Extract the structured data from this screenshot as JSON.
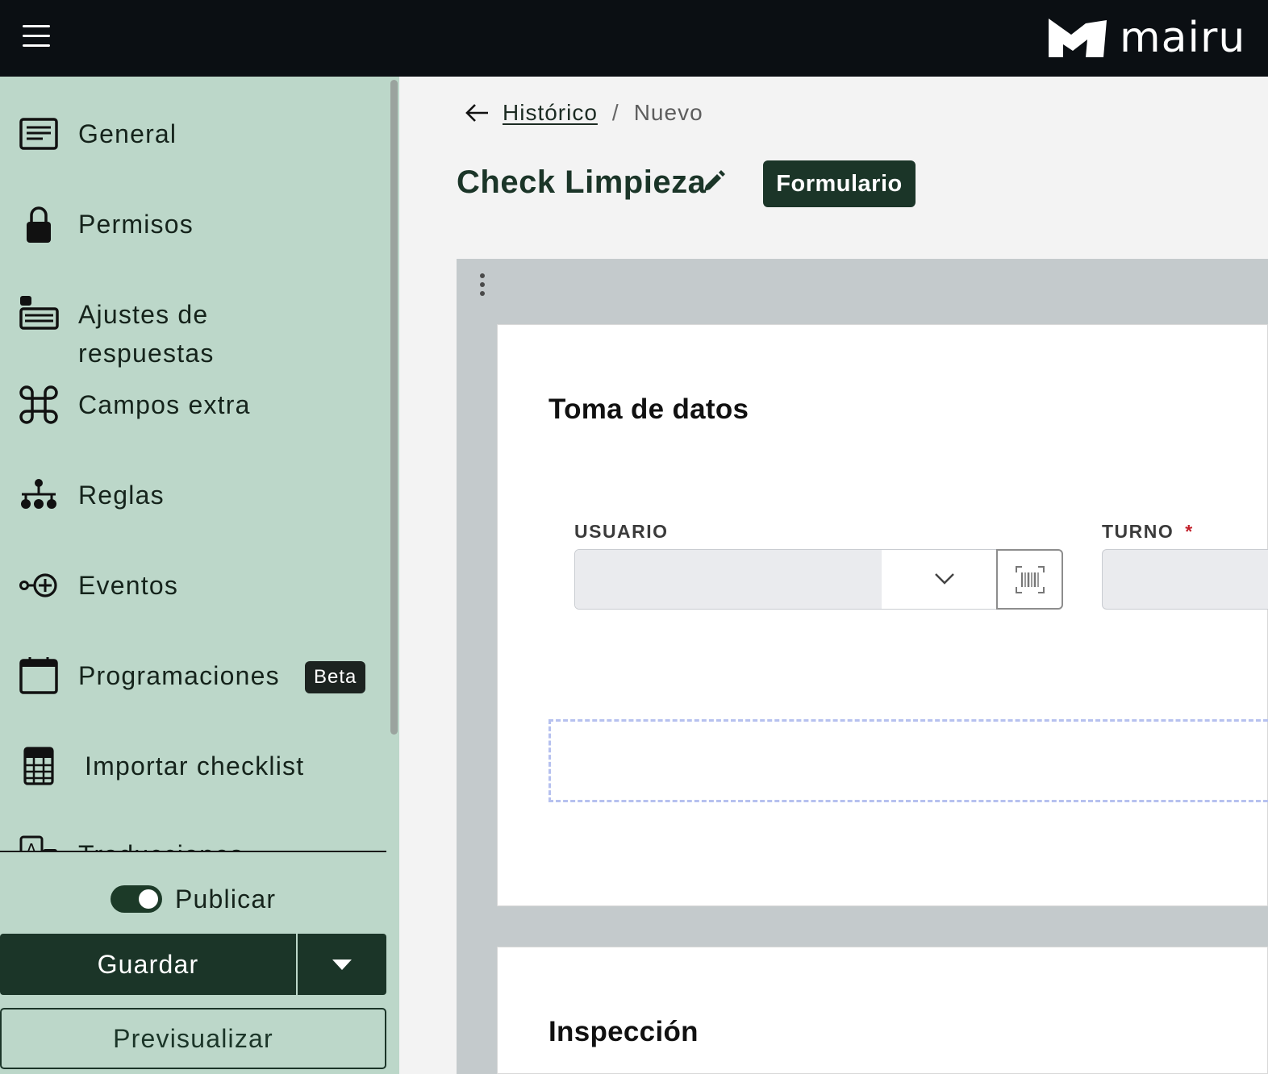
{
  "app": {
    "logo_text": "mairu"
  },
  "sidebar": {
    "items": [
      {
        "label": "General",
        "icon": "list-card-icon"
      },
      {
        "label": "Permisos",
        "icon": "lock-icon"
      },
      {
        "label": "Ajustes de respuestas",
        "icon": "response-settings-icon"
      },
      {
        "label": "Campos extra",
        "icon": "command-icon"
      },
      {
        "label": "Reglas",
        "icon": "rules-tree-icon"
      },
      {
        "label": "Eventos",
        "icon": "event-plus-icon"
      },
      {
        "label": "Programaciones",
        "icon": "calendar-icon",
        "badge": "Beta"
      },
      {
        "label": "Importar checklist",
        "icon": "calculator-sheet-icon"
      },
      {
        "label": "Traducciones",
        "icon": "translate-icon"
      }
    ],
    "publish_label": "Publicar",
    "publish_on": true,
    "save_label": "Guardar",
    "preview_label": "Previsualizar"
  },
  "breadcrumb": {
    "parent": "Histórico",
    "separator": "/",
    "current": "Nuevo"
  },
  "page": {
    "title": "Check Limpieza",
    "type_badge": "Formulario"
  },
  "form": {
    "sections": [
      {
        "title": "Toma de datos",
        "fields": [
          {
            "label": "USUARIO",
            "required": false,
            "value": ""
          },
          {
            "label": "TURNO",
            "required": true,
            "required_mark": "*",
            "value": ""
          }
        ]
      },
      {
        "title": "Inspección"
      }
    ]
  },
  "colors": {
    "topbar": "#0b0f13",
    "sidebar": "#bcd7c9",
    "primary": "#1b3528",
    "required": "#c21f2a",
    "dropzone_border": "#b6c1ef"
  }
}
